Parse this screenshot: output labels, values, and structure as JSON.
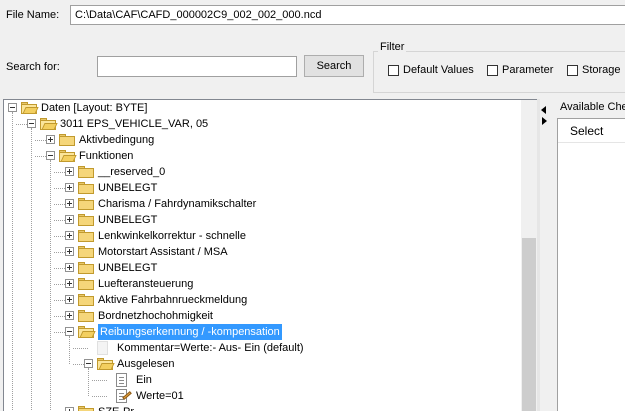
{
  "file": {
    "label": "File Name:",
    "value": "C:\\Data\\CAF\\CAFD_000002C9_002_002_000.ncd"
  },
  "search": {
    "label": "Search for:",
    "value": "",
    "button": "Search"
  },
  "filter": {
    "title": "Filter",
    "options": [
      {
        "label": "Default Values",
        "checked": false
      },
      {
        "label": "Parameter",
        "checked": false
      },
      {
        "label": "Storage",
        "checked": false
      }
    ]
  },
  "tree": {
    "nodes": [
      {
        "text": "Daten [Layout: BYTE]",
        "level": 0,
        "icon": "folder-open-icon",
        "expander": "minus"
      },
      {
        "text": "3011 EPS_VEHICLE_VAR, 05",
        "level": 1,
        "icon": "folder-open-icon",
        "expander": "minus"
      },
      {
        "text": "Aktivbedingung",
        "level": 2,
        "icon": "folder-icon",
        "expander": "plus"
      },
      {
        "text": "Funktionen",
        "level": 2,
        "icon": "folder-open-icon",
        "expander": "minus"
      },
      {
        "text": "__reserved_0",
        "level": 3,
        "icon": "folder-icon",
        "expander": "plus"
      },
      {
        "text": "UNBELEGT",
        "level": 3,
        "icon": "folder-icon",
        "expander": "plus"
      },
      {
        "text": "Charisma / Fahrdynamikschalter",
        "level": 3,
        "icon": "folder-icon",
        "expander": "plus"
      },
      {
        "text": "UNBELEGT",
        "level": 3,
        "icon": "folder-icon",
        "expander": "plus"
      },
      {
        "text": "Lenkwinkelkorrektur - schnelle",
        "level": 3,
        "icon": "folder-icon",
        "expander": "plus"
      },
      {
        "text": "Motorstart Assistant / MSA",
        "level": 3,
        "icon": "folder-icon",
        "expander": "plus"
      },
      {
        "text": "UNBELEGT",
        "level": 3,
        "icon": "folder-icon",
        "expander": "plus"
      },
      {
        "text": "Luefteransteuerung",
        "level": 3,
        "icon": "folder-icon",
        "expander": "plus"
      },
      {
        "text": "Aktive Fahrbahnrueckmeldung",
        "level": 3,
        "icon": "folder-icon",
        "expander": "plus"
      },
      {
        "text": "Bordnetzhochohmigkeit",
        "level": 3,
        "icon": "folder-icon",
        "expander": "plus"
      },
      {
        "text": "Reibungserkennung / -kompensation",
        "level": 3,
        "icon": "folder-open-icon",
        "expander": "minus",
        "selected": true
      },
      {
        "text": "Kommentar=Werte:- Aus- Ein (default)",
        "level": 4,
        "icon": "blank-doc-icon",
        "expander": "none"
      },
      {
        "text": "Ausgelesen",
        "level": 4,
        "icon": "folder-open-icon",
        "expander": "minus"
      },
      {
        "text": "Ein",
        "level": 5,
        "icon": "document-icon",
        "expander": "none"
      },
      {
        "text": "Werte=01",
        "level": 5,
        "icon": "edit-document-icon",
        "expander": "none"
      },
      {
        "text": "SZE-Pr...",
        "level": 3,
        "icon": "folder-icon",
        "expander": "plus"
      }
    ]
  },
  "right_panel": {
    "title": "Available Che",
    "column": "Select"
  }
}
